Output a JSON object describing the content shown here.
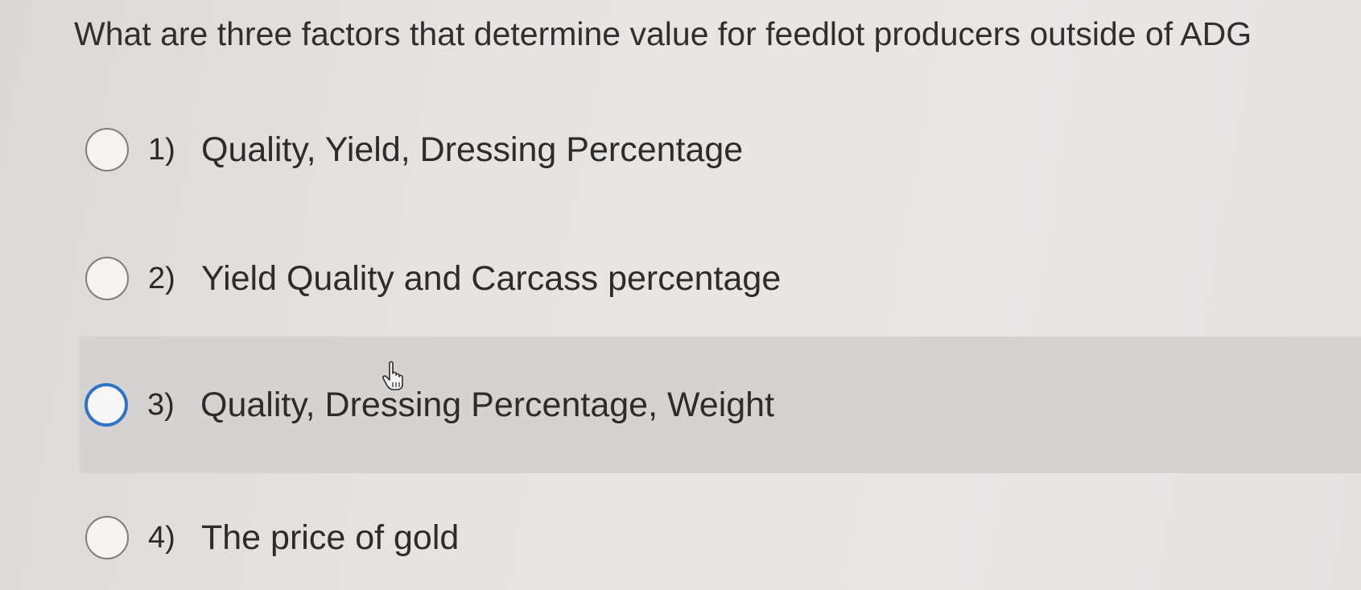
{
  "question": {
    "text": "What are three factors that determine value for feedlot producers outside of ADG"
  },
  "options": [
    {
      "number": "1)",
      "label": "Quality, Yield, Dressing Percentage"
    },
    {
      "number": "2)",
      "label": "Yield Quality and Carcass percentage"
    },
    {
      "number": "3)",
      "label": "Quality, Dressing Percentage, Weight"
    },
    {
      "number": "4)",
      "label": "The price of gold"
    }
  ],
  "colors": {
    "hover_background": "#d5d3d2",
    "focus_ring": "#2f73c4",
    "radio_border": "#7d7d7d"
  },
  "icons": {
    "cursor": "hand-pointer-icon"
  }
}
